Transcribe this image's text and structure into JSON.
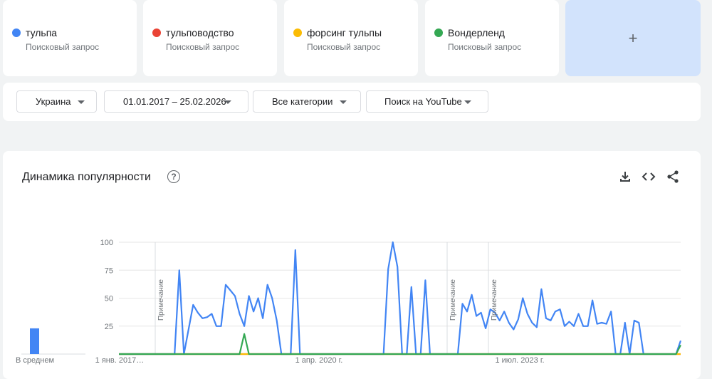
{
  "terms": [
    {
      "name": "тульпа",
      "type": "Поисковый запрос",
      "color": "#4285f4"
    },
    {
      "name": "тульповодство",
      "type": "Поисковый запрос",
      "color": "#ea4335"
    },
    {
      "name": "форсинг тульпы",
      "type": "Поисковый запрос",
      "color": "#fbbc04"
    },
    {
      "name": "Вондерленд",
      "type": "Поисковый запрос",
      "color": "#34a853"
    }
  ],
  "add_term": {
    "label": "+"
  },
  "filters": {
    "region": "Украина",
    "period": "01.01.2017 – 25.02.2026",
    "category": "Все категории",
    "source": "Поиск на YouTube"
  },
  "panel": {
    "title": "Динамика популярности",
    "help_icon": "help-circle-icon",
    "tools": [
      "download-icon",
      "embed-code-icon",
      "share-icon"
    ]
  },
  "average": {
    "label": "В среднем",
    "values": [
      {
        "series": "тульпа",
        "value": 23
      }
    ]
  },
  "chart_data": {
    "type": "line",
    "ylim": [
      0,
      100
    ],
    "yticks": [
      25,
      50,
      75,
      100
    ],
    "x_tick_labels": [
      "1 янв. 2017…",
      "1 апр. 2020 г.",
      "1 июл. 2023 г."
    ],
    "notes": [
      "Примечание",
      "Примечание",
      "Примечание"
    ],
    "series": [
      {
        "name": "тульпа",
        "color": "#4285f4",
        "values": [
          0,
          0,
          0,
          0,
          0,
          0,
          0,
          0,
          0,
          0,
          0,
          0,
          0,
          75,
          0,
          22,
          44,
          37,
          32,
          33,
          36,
          25,
          25,
          62,
          57,
          52,
          36,
          25,
          52,
          38,
          50,
          32,
          62,
          50,
          30,
          0,
          0,
          0,
          93,
          0,
          0,
          0,
          0,
          0,
          0,
          0,
          0,
          0,
          0,
          0,
          0,
          0,
          0,
          0,
          0,
          0,
          0,
          0,
          76,
          100,
          78,
          0,
          0,
          60,
          0,
          0,
          66,
          0,
          0,
          0,
          0,
          0,
          0,
          0,
          45,
          38,
          53,
          34,
          37,
          23,
          40,
          37,
          30,
          38,
          28,
          22,
          31,
          50,
          36,
          28,
          24,
          58,
          32,
          30,
          38,
          40,
          25,
          29,
          25,
          36,
          25,
          25,
          48,
          27,
          28,
          27,
          38,
          0,
          0,
          28,
          0,
          30,
          28,
          0,
          0,
          0,
          0,
          0,
          0,
          0,
          0,
          12
        ]
      },
      {
        "name": "тульповодство",
        "color": "#ea4335",
        "values": [
          0,
          0,
          0,
          0,
          0,
          0,
          0,
          0,
          0,
          0,
          0,
          0,
          0,
          0,
          0,
          0,
          0,
          0,
          0,
          0,
          0,
          0,
          0,
          0,
          0,
          0,
          0,
          0,
          0,
          0,
          0,
          0,
          0,
          0,
          0,
          0,
          0,
          0,
          0,
          0,
          0,
          0,
          0,
          0,
          0,
          0,
          0,
          0,
          0,
          0,
          0,
          0,
          0,
          0,
          0,
          0,
          0,
          0,
          0,
          0,
          0,
          0,
          0,
          0,
          0,
          0,
          0,
          0,
          0,
          0,
          0,
          0,
          0,
          0,
          0,
          0,
          0,
          0,
          0,
          0,
          0,
          0,
          0,
          0,
          0,
          0,
          0,
          0,
          0,
          0,
          0,
          0,
          0,
          0,
          0,
          0,
          0,
          0,
          0,
          0,
          0,
          0,
          0,
          0,
          0,
          0,
          0,
          0,
          0,
          0,
          0,
          0,
          0,
          0,
          0,
          0,
          0,
          0,
          0,
          0,
          0,
          0
        ]
      },
      {
        "name": "форсинг тульпы",
        "color": "#fbbc04",
        "values": [
          0,
          0,
          0,
          0,
          0,
          0,
          0,
          0,
          0,
          0,
          0,
          0,
          0,
          0,
          0,
          0,
          0,
          0,
          0,
          0,
          0,
          0,
          0,
          0,
          0,
          0,
          0,
          0,
          0,
          0,
          0,
          0,
          0,
          0,
          0,
          0,
          0,
          0,
          0,
          0,
          0,
          0,
          0,
          0,
          0,
          0,
          0,
          0,
          0,
          0,
          0,
          0,
          0,
          0,
          0,
          0,
          0,
          0,
          0,
          0,
          0,
          0,
          0,
          0,
          0,
          0,
          0,
          0,
          0,
          0,
          0,
          0,
          0,
          0,
          0,
          0,
          0,
          0,
          0,
          0,
          0,
          0,
          0,
          0,
          0,
          0,
          0,
          0,
          0,
          0,
          0,
          0,
          0,
          0,
          0,
          0,
          0,
          0,
          0,
          0,
          0,
          0,
          0,
          0,
          0,
          0,
          0,
          0,
          0,
          0,
          0,
          0,
          0,
          0,
          0,
          0,
          0,
          0,
          0,
          0,
          0,
          0
        ]
      },
      {
        "name": "Вондерленд",
        "color": "#34a853",
        "values": [
          0,
          0,
          0,
          0,
          0,
          0,
          0,
          0,
          0,
          0,
          0,
          0,
          0,
          0,
          0,
          0,
          0,
          0,
          0,
          0,
          0,
          0,
          0,
          0,
          0,
          0,
          0,
          18,
          0,
          0,
          0,
          0,
          0,
          0,
          0,
          0,
          0,
          0,
          0,
          0,
          0,
          0,
          0,
          0,
          0,
          0,
          0,
          0,
          0,
          0,
          0,
          0,
          0,
          0,
          0,
          0,
          0,
          0,
          0,
          0,
          0,
          0,
          0,
          0,
          0,
          0,
          0,
          0,
          0,
          0,
          0,
          0,
          0,
          0,
          0,
          0,
          0,
          0,
          0,
          0,
          0,
          0,
          0,
          0,
          0,
          0,
          0,
          0,
          0,
          0,
          0,
          0,
          0,
          0,
          0,
          0,
          0,
          0,
          0,
          0,
          0,
          0,
          0,
          0,
          0,
          0,
          0,
          0,
          0,
          0,
          0,
          0,
          0,
          0,
          0,
          0,
          0,
          0,
          0,
          0,
          0,
          8
        ]
      }
    ]
  }
}
